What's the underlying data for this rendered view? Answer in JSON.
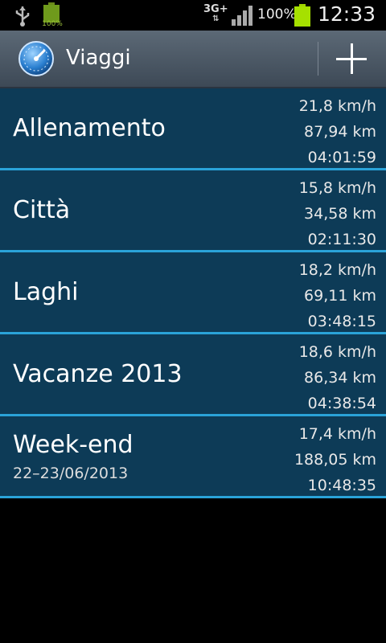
{
  "status_bar": {
    "battery_small_pct": "100%",
    "network": "3G+",
    "network_arrows": "⇅",
    "battery_pct": "100%",
    "time": "12:33"
  },
  "action_bar": {
    "title": "Viaggi",
    "add_icon": "plus-icon"
  },
  "trips": [
    {
      "name": "Allenamento",
      "subtitle": "",
      "speed": "21,8 km/h",
      "distance": "87,94 km",
      "duration": "04:01:59"
    },
    {
      "name": "Città",
      "subtitle": "",
      "speed": "15,8 km/h",
      "distance": "34,58 km",
      "duration": "02:11:30"
    },
    {
      "name": "Laghi",
      "subtitle": "",
      "speed": "18,2 km/h",
      "distance": "69,11 km",
      "duration": "03:48:15"
    },
    {
      "name": "Vacanze 2013",
      "subtitle": "",
      "speed": "18,6 km/h",
      "distance": "86,34 km",
      "duration": "04:38:54"
    },
    {
      "name": "Week-end",
      "subtitle": "22–23/06/2013",
      "speed": "17,4 km/h",
      "distance": "188,05 km",
      "duration": "10:48:35"
    }
  ],
  "colors": {
    "list_bg": "#0d3b57",
    "divider": "#2aa3d9",
    "action_bar": "#4a5663"
  }
}
